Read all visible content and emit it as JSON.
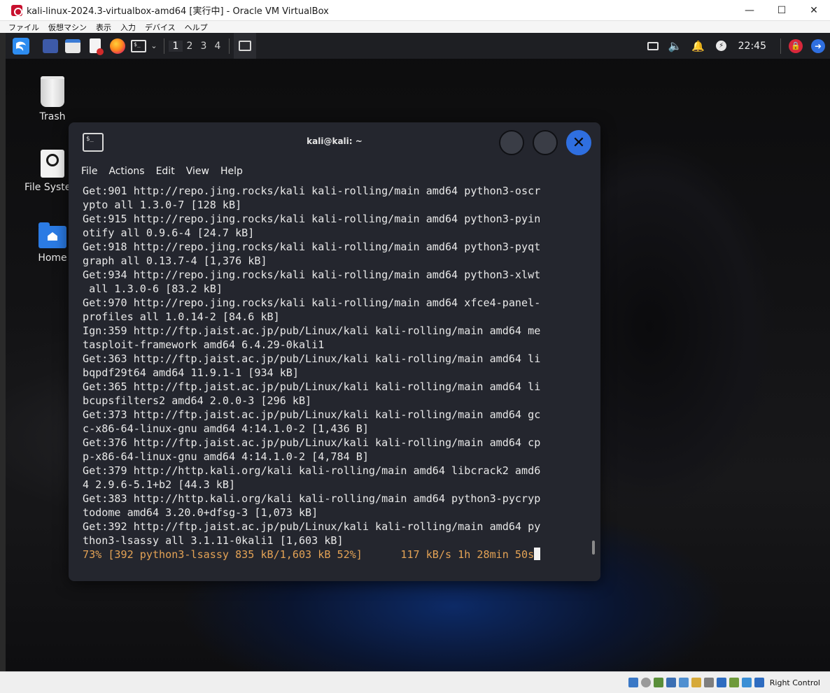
{
  "host": {
    "window_title": "kali-linux-2024.3-virtualbox-amd64 [実行中] - Oracle VM VirtualBox",
    "menu": [
      "ファイル",
      "仮想マシン",
      "表示",
      "入力",
      "デバイス",
      "ヘルプ"
    ],
    "status_right_label": "Right Control"
  },
  "panel": {
    "workspaces": [
      "1",
      "2",
      "3",
      "4"
    ],
    "active_workspace": "1",
    "clock": "22:45"
  },
  "desktop": {
    "icons": [
      {
        "label": "Trash",
        "icon": "trash-icon"
      },
      {
        "label": "File System",
        "icon": "drive-icon"
      },
      {
        "label": "Home",
        "icon": "folder-home-icon"
      }
    ]
  },
  "terminal": {
    "title": "kali@kali: ~",
    "menu": [
      "File",
      "Actions",
      "Edit",
      "View",
      "Help"
    ],
    "lines": [
      "Get:901 http://repo.jing.rocks/kali kali-rolling/main amd64 python3-oscr",
      "ypto all 1.3.0-7 [128 kB]",
      "Get:915 http://repo.jing.rocks/kali kali-rolling/main amd64 python3-pyin",
      "otify all 0.9.6-4 [24.7 kB]",
      "Get:918 http://repo.jing.rocks/kali kali-rolling/main amd64 python3-pyqt",
      "graph all 0.13.7-4 [1,376 kB]",
      "Get:934 http://repo.jing.rocks/kali kali-rolling/main amd64 python3-xlwt",
      " all 1.3.0-6 [83.2 kB]",
      "Get:970 http://repo.jing.rocks/kali kali-rolling/main amd64 xfce4-panel-",
      "profiles all 1.0.14-2 [84.6 kB]",
      "Ign:359 http://ftp.jaist.ac.jp/pub/Linux/kali kali-rolling/main amd64 me",
      "tasploit-framework amd64 6.4.29-0kali1",
      "Get:363 http://ftp.jaist.ac.jp/pub/Linux/kali kali-rolling/main amd64 li",
      "bqpdf29t64 amd64 11.9.1-1 [934 kB]",
      "Get:365 http://ftp.jaist.ac.jp/pub/Linux/kali kali-rolling/main amd64 li",
      "bcupsfilters2 amd64 2.0.0-3 [296 kB]",
      "Get:373 http://ftp.jaist.ac.jp/pub/Linux/kali kali-rolling/main amd64 gc",
      "c-x86-64-linux-gnu amd64 4:14.1.0-2 [1,436 B]",
      "Get:376 http://ftp.jaist.ac.jp/pub/Linux/kali kali-rolling/main amd64 cp",
      "p-x86-64-linux-gnu amd64 4:14.1.0-2 [4,784 B]",
      "Get:379 http://http.kali.org/kali kali-rolling/main amd64 libcrack2 amd6",
      "4 2.9.6-5.1+b2 [44.3 kB]",
      "Get:383 http://http.kali.org/kali kali-rolling/main amd64 python3-pycryp",
      "todome amd64 3.20.0+dfsg-3 [1,073 kB]",
      "Get:392 http://ftp.jaist.ac.jp/pub/Linux/kali kali-rolling/main amd64 py",
      "thon3-lsassy all 3.1.11-0kali1 [1,603 kB]"
    ],
    "progress_line": "73% [392 python3-lsassy 835 kB/1,603 kB 52%]      117 kB/s 1h 28min 50s"
  }
}
